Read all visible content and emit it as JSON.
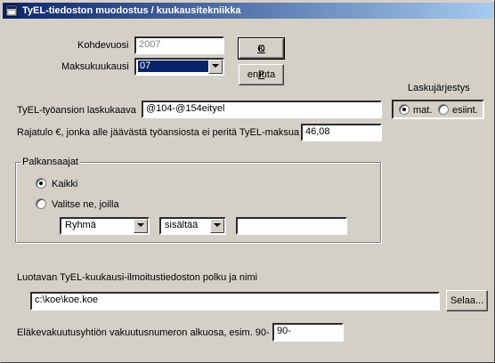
{
  "window": {
    "title": "TyEL-tiedoston muodostus / kuukausitekniikka"
  },
  "period": {
    "year_label": "Kohdevuosi",
    "year_value": "2007",
    "month_label": "Maksukuukausi",
    "month_value": "07"
  },
  "buttons": {
    "ok": "OK",
    "ok_hotkey": "O",
    "ok_rest": "K",
    "cancel": "Peruuta",
    "cancel_hotkey": "P",
    "cancel_rest": "eruuta",
    "browse": "Selaa..."
  },
  "sort_order": {
    "label": "Laskujärjestys",
    "option_mat": "mat.",
    "option_esiint": "esiint.",
    "selected": "mat."
  },
  "formula": {
    "label": "TyEL-työansion laskukaava",
    "value": "@104-@154eityel"
  },
  "threshold": {
    "label": "Rajatulo €, jonka alle jäävästä työansiosta ei peritä TyEL-maksua",
    "value": "46,08"
  },
  "employees": {
    "group_label": "Palkansaajat",
    "option_all": "Kaikki",
    "option_select": "Valitse ne, joilla",
    "selected": "Kaikki",
    "filter_field": "Ryhmä",
    "filter_operator": "sisältää",
    "filter_value": ""
  },
  "output_file": {
    "label": "Luotavan TyEL-kuukausi-ilmoitustiedoston polku ja nimi",
    "value": "c:\\koe\\koe.koe"
  },
  "insurance_prefix": {
    "label": "Eläkevakuutusyhtiön vakuutusnumeron alkuosa, esim. 90-",
    "value": "90-"
  },
  "icons": {
    "app": "app-window-icon",
    "dropdown": "chevron-down-icon"
  }
}
